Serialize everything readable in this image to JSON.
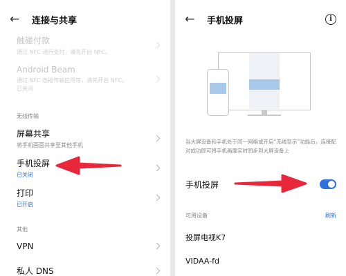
{
  "left": {
    "title": "连接与共享",
    "back_icon": "←",
    "rows": [
      {
        "label": "触碰付款",
        "sub": "通过 NFC 进行支付，请先开启 NFC。",
        "disabled": true
      },
      {
        "label": "Android Beam",
        "sub": "通过 NFC 连接传输应用等，请先开启 NFC。\n已关闭",
        "disabled": true
      },
      {
        "label": "屏幕共享",
        "sub": "将手机画面共享至其他手机"
      },
      {
        "label": "手机投屏",
        "sub": "已关闭"
      },
      {
        "label": "打印",
        "sub": "已开启"
      },
      {
        "label": "VPN",
        "sub": ""
      },
      {
        "label": "私人 DNS",
        "sub": ""
      }
    ],
    "section_wireless": "无线传输",
    "section_other": "其他"
  },
  "right": {
    "title": "手机投屏",
    "back_icon": "←",
    "info_icon": "i",
    "description": "当大屏设备和手机处于同一网络或开启“无线显示”功能后，连接配对成功即可将手机画面实时同步到大屏设备上",
    "toggle_label": "手机投屏",
    "toggle_on": true,
    "available_label": "可用设备",
    "refresh_label": "刷新",
    "devices": [
      "投屏电视K7",
      "VIDAA-fd"
    ]
  },
  "colors": {
    "accent": "#2f6fe0",
    "arrow": "#e8283a",
    "link": "#2a6fd8"
  }
}
